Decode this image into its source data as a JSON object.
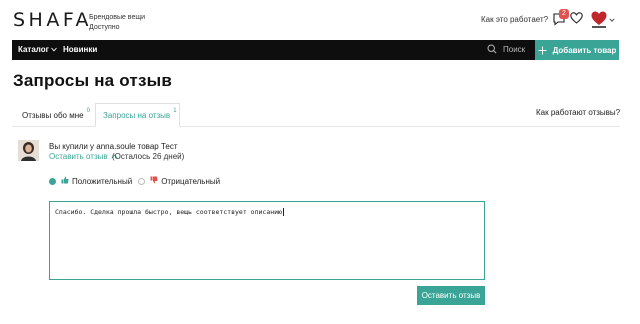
{
  "header": {
    "logo": "SHAFA",
    "tagline_line1": "Брендовые вещи",
    "tagline_line2": "Доступно",
    "how_it_works": "Как это работает?",
    "messages_count": "2"
  },
  "nav": {
    "catalog": "Каталог",
    "new": "Новинки",
    "search_placeholder": "Поиск",
    "add_item": "Добавить товар"
  },
  "page": {
    "title": "Запросы на отзыв"
  },
  "tabs": [
    {
      "label": "Отзывы обо мне",
      "count": "0"
    },
    {
      "label": "Запросы на отзыв",
      "count": "1"
    }
  ],
  "how_reviews_work": "Как работают отзывы?",
  "purchase": {
    "text": "Вы купили у anna.soule товар Тест",
    "leave_review": "Оставить отзыв",
    "remaining": "(Осталось 26 дней)"
  },
  "rating": {
    "positive_label": "Положительный",
    "negative_label": "Отрицательный",
    "selected": "positive"
  },
  "review": {
    "text": "Спасибо. Сделка прошла быстро, вещь соответствует описанию"
  },
  "submit_label": "Оставить отзыв",
  "colors": {
    "accent": "#3aa597",
    "nav_bg": "#0e0e0e",
    "badge": "#e0524f",
    "heart": "#c0272d"
  }
}
